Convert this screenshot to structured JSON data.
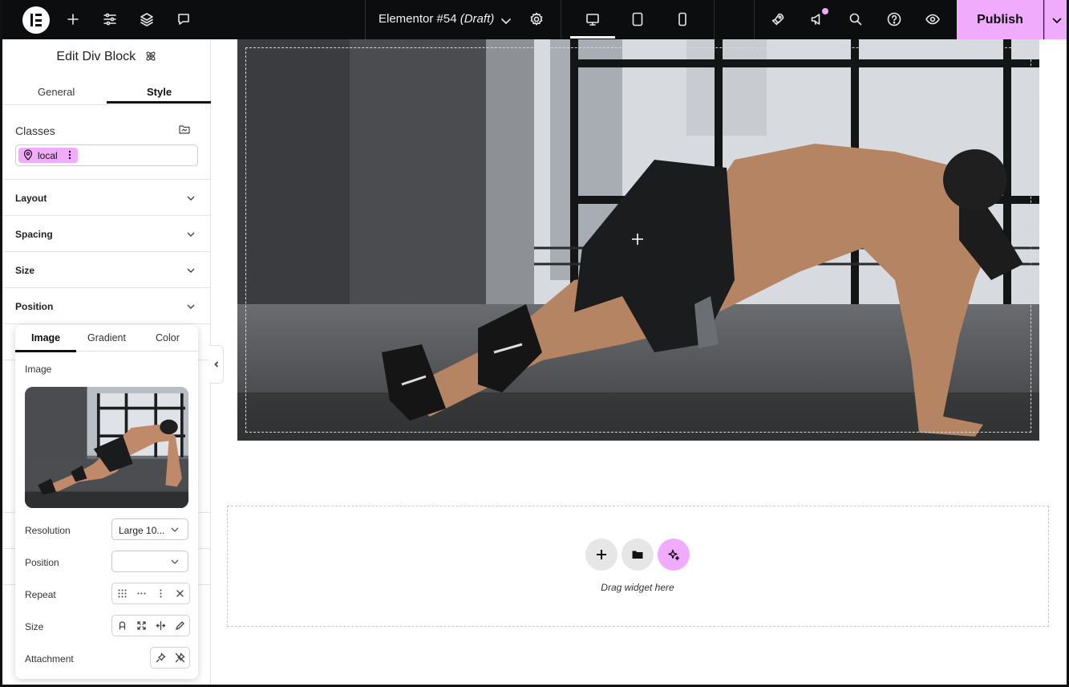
{
  "topbar": {
    "document_title": "Elementor #54",
    "document_status": "(Draft)",
    "publish_label": "Publish",
    "accent_color": "#f0abfc",
    "icons": [
      "elementor-logo-icon",
      "add-element-icon",
      "site-settings-icon",
      "structure-layers-icon",
      "notes-comment-icon",
      "page-settings-gear-icon",
      "desktop-device-icon",
      "tablet-device-icon",
      "mobile-device-icon",
      "launchpad-rocket-icon",
      "whats-new-megaphone-icon",
      "search-icon",
      "help-icon",
      "preview-eye-icon",
      "publish-options-chevron-icon"
    ]
  },
  "panel": {
    "title": "Edit Div Block",
    "tabs": [
      {
        "label": "General",
        "active": false
      },
      {
        "label": "Style",
        "active": true
      }
    ],
    "classes": {
      "label": "Classes",
      "chip_label": "local"
    },
    "sections": [
      {
        "label": "Layout"
      },
      {
        "label": "Spacing"
      },
      {
        "label": "Size"
      },
      {
        "label": "Position"
      }
    ]
  },
  "background_popover": {
    "tabs": [
      {
        "label": "Image",
        "active": true
      },
      {
        "label": "Gradient",
        "active": false
      },
      {
        "label": "Color",
        "active": false
      }
    ],
    "image_label": "Image",
    "resolution": {
      "label": "Resolution",
      "value": "Large 10..."
    },
    "position": {
      "label": "Position",
      "value": ""
    },
    "repeat": {
      "label": "Repeat",
      "options": [
        "repeat-icon",
        "repeat-x-icon",
        "repeat-y-icon",
        "no-repeat-icon"
      ]
    },
    "size": {
      "label": "Size",
      "options": [
        "size-auto-icon",
        "size-cover-icon",
        "size-contain-icon",
        "size-custom-pencil-icon"
      ]
    },
    "attachment": {
      "label": "Attachment",
      "options": [
        "attachment-fixed-pin-icon",
        "attachment-scroll-pin-off-icon"
      ]
    }
  },
  "canvas": {
    "dropzone_text": "Drag widget here"
  }
}
